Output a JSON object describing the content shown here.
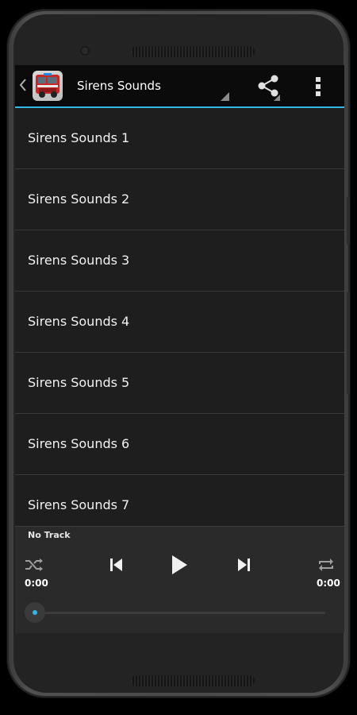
{
  "actionbar": {
    "title": "Sirens Sounds",
    "back_icon": "chevron-left-icon",
    "app_icon": "fire-truck-icon",
    "share_icon": "share-icon",
    "overflow_icon": "more-vertical-icon",
    "accent_color": "#33b5e5"
  },
  "list": {
    "items": [
      {
        "label": "Sirens Sounds 1"
      },
      {
        "label": "Sirens Sounds 2"
      },
      {
        "label": "Sirens Sounds 3"
      },
      {
        "label": "Sirens Sounds 4"
      },
      {
        "label": "Sirens Sounds 5"
      },
      {
        "label": "Sirens Sounds 6"
      },
      {
        "label": "Sirens Sounds 7"
      }
    ]
  },
  "player": {
    "track_name": "No Track",
    "elapsed_time": "0:00",
    "total_time": "0:00",
    "progress": 0,
    "controls": {
      "shuffle_icon": "shuffle-icon",
      "previous_icon": "skip-previous-icon",
      "play_icon": "play-icon",
      "next_icon": "skip-next-icon",
      "repeat_icon": "repeat-icon"
    }
  }
}
